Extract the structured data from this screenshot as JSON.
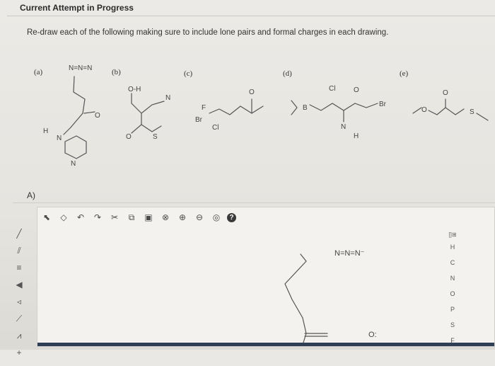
{
  "header": {
    "title": "Current Attempt in Progress"
  },
  "question": {
    "instruction": "Re-draw each of the following making sure to include lone pairs and formal charges in each drawing.",
    "parts": [
      "(a)",
      "(b)",
      "(c)",
      "(d)",
      "(e)"
    ]
  },
  "molecule_labels": {
    "a": {
      "azide": "N=N=N",
      "hydrazine_h": "H",
      "ring_n1": "N",
      "ring_n2": "N",
      "carbonyl_o": "O"
    },
    "b": {
      "hydroxyl": "O-H",
      "nitrile": "N",
      "carbonyl_o": "O",
      "thio": "S"
    },
    "c": {
      "f": "F",
      "br": "Br",
      "cl": "Cl",
      "carbonyl_o": "O"
    },
    "d": {
      "boron": "B",
      "cl": "Cl",
      "ether_o": "O",
      "br": "Br",
      "amine_n": "N",
      "amine_h": "H"
    },
    "e": {
      "ether_o": "O",
      "carbonyl_o": "O",
      "thio": "S"
    }
  },
  "answer": {
    "label": "A)",
    "drawn_azide": "N=N=N⁻",
    "drawn_o": "O:"
  },
  "toolbar": {
    "tools": [
      "select-arrow-icon",
      "eraser-icon",
      "undo-icon",
      "redo-icon",
      "cut-icon",
      "copy-icon",
      "paste-icon",
      "zoom-custom-icon",
      "zoom-in-icon",
      "zoom-out-icon",
      "zoom-fit-icon",
      "help-icon"
    ],
    "help_glyph": "?"
  },
  "left_tools": [
    "single-bond",
    "double-bond",
    "triple-bond",
    "wedge-bond",
    "dash-bond",
    "stereo-bond",
    "chain",
    "charge-plus"
  ],
  "atom_palette": [
    "H",
    "C",
    "N",
    "O",
    "P",
    "S",
    "F"
  ],
  "periodic_label": "[]⊞"
}
